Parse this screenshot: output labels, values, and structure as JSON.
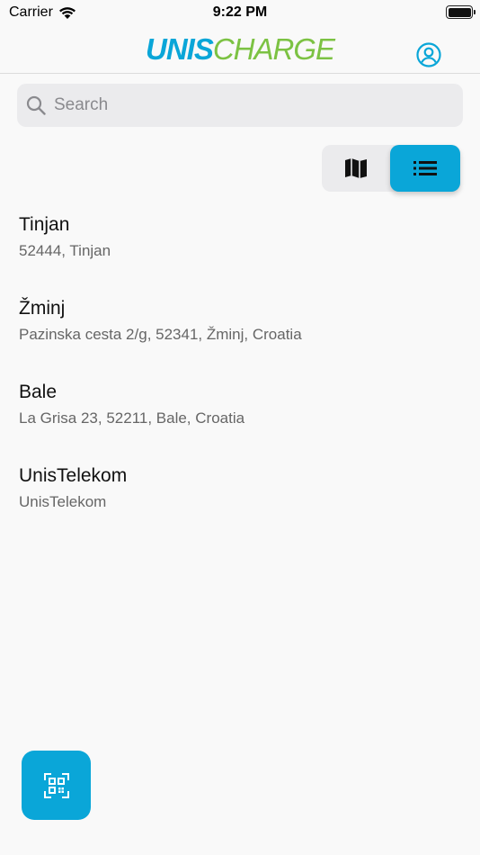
{
  "status_bar": {
    "carrier": "Carrier",
    "time": "9:22 PM"
  },
  "header": {
    "logo_part1": "UNIS",
    "logo_part2": "CHARGE"
  },
  "search": {
    "placeholder": "Search",
    "value": ""
  },
  "view_toggle": {
    "options": [
      "map",
      "list"
    ],
    "selected": "list"
  },
  "locations": [
    {
      "name": "Tinjan",
      "address": "52444, Tinjan"
    },
    {
      "name": "Žminj",
      "address": "Pazinska cesta 2/g, 52341, Žminj, Croatia"
    },
    {
      "name": "Bale",
      "address": "La Grisa 23, 52211, Bale, Croatia"
    },
    {
      "name": "UnisTelekom",
      "address": "UnisTelekom"
    }
  ],
  "colors": {
    "accent": "#0aa6d8",
    "logo_green": "#7cc243",
    "background": "#f9f9f9"
  },
  "icons": {
    "profile": "user-circle-icon",
    "search": "search-icon",
    "map": "map-icon",
    "list": "list-icon",
    "qr": "qr-scan-icon"
  }
}
